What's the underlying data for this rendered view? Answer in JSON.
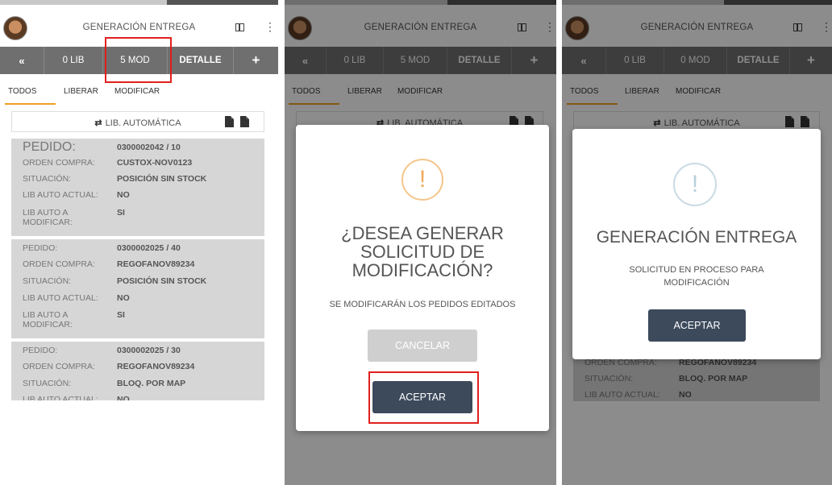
{
  "app": {
    "title": "GENERACIÓN ENTREGA"
  },
  "toolbar": {
    "back": "«",
    "lib": "0 LIB",
    "mod_panel1": "5 MOD",
    "mod_panel2": "5 MOD",
    "mod_panel3": "0 MOD",
    "detalle": "DETALLE",
    "plus": "+"
  },
  "tabs": {
    "todos": "TODOS",
    "liberar": "LIBERAR",
    "modificar": "MODIFICAR"
  },
  "lib_auto": {
    "arrows": "⇄",
    "label": "LIB. AUTOMÁTICA"
  },
  "labels": {
    "pedido": "PEDIDO:",
    "orden": "ORDEN COMPRA:",
    "situacion": "SITUACIÓN:",
    "lib_actual": "LIB AUTO ACTUAL:",
    "lib_modificar": "LIB AUTO A MODIFICAR:"
  },
  "orders": [
    {
      "pedido": "0300002042 / 10",
      "orden": "CUSTOX-NOV0123",
      "situacion": "POSICIÓN SIN STOCK",
      "lib_actual": "NO",
      "lib_modificar": "SI"
    },
    {
      "pedido": "0300002025 / 40",
      "orden": "REGOFANOV89234",
      "situacion": "POSICIÓN SIN STOCK",
      "lib_actual": "NO",
      "lib_modificar": "SI"
    },
    {
      "pedido": "0300002025 / 30",
      "orden": "REGOFANOV89234",
      "situacion": "BLOQ. POR MAP",
      "lib_actual": "NO"
    }
  ],
  "confirm_dialog": {
    "icon": "!",
    "title_line1": "¿DESEA GENERAR",
    "title_line2": "SOLICITUD DE",
    "title_line3": "MODIFICACIÓN?",
    "text": "SE MODIFICARÁN LOS PEDIDOS EDITADOS",
    "cancel": "CANCELAR",
    "accept": "ACEPTAR"
  },
  "info_dialog": {
    "icon": "!",
    "title": "GENERACIÓN ENTREGA",
    "text_line1": "SOLICITUD EN PROCESO PARA",
    "text_line2": "MODIFICACIÓN",
    "accept": "ACEPTAR"
  },
  "colors": {
    "toolbar": "#6f6f6f",
    "card": "#d6d6d6",
    "tab_accent": "#f0a020",
    "accept_button": "#3c4a5b",
    "highlight": "#e0201e",
    "warning_icon": "#f0a95c"
  }
}
